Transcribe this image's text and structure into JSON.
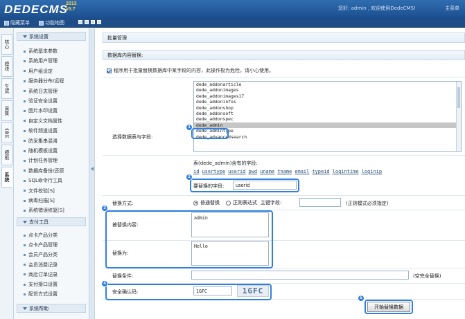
{
  "header": {
    "logo_text": "DEDECMS",
    "logo_version_top": "2013",
    "logo_version_bottom": "v5.7",
    "welcome_text": "您好: admin , 欢迎使用DedeCMS!",
    "right_link": "主菜单"
  },
  "toolbar": {
    "hide_menu": "隐藏菜单",
    "function_map": "功能地图"
  },
  "vtabs": [
    "核心",
    "模块",
    "生成",
    "采集",
    "会员",
    "模板",
    "系统"
  ],
  "sidemenu": {
    "group1_title": "系统设置",
    "group1_items": [
      "系统基本参数",
      "系统用户管理",
      "用户组设定",
      "服务器分布/远程",
      "系统日志管理",
      "验证安全设置",
      "图片水印设置",
      "自定义文档属性",
      "软件频道设置",
      "防采集串混淆",
      "随机模板设置",
      "计划任务管理",
      "数据库备份/还原",
      "SQL命令行工具",
      "文件校验[S]",
      "病毒扫描[S]",
      "系统错误修复[S]"
    ],
    "group2_title": "支付工具",
    "group2_items": [
      "点卡产品分类",
      "点卡产品管理",
      "会员产品分类",
      "会员消费记录",
      "商店订单记录",
      "支付接口设置",
      "配货方式设置"
    ],
    "group3_title": "系统帮助"
  },
  "main": {
    "title": "批量管理",
    "subtitle": "数据库内容替换:",
    "notice": "程序用于批量替换数据库中某字段的内容，此操作极为危险，请小心使用。",
    "table_label": "选择数据表与字段:",
    "tables": [
      "dede_addonarticle",
      "dede_addonimages",
      "dede_addonimages17",
      "dede_addoninfos",
      "dede_addonshop",
      "dede_addonsoft",
      "dede_addonspec",
      "dede_admin",
      "dede_admintype",
      "dede_advancedsearch"
    ],
    "selected_table": "dede_admin",
    "fields_title": "表(dede_admin)含有的字段:",
    "fields": [
      "id",
      "usertype",
      "userid",
      "pwd",
      "uname",
      "tname",
      "email",
      "typeid",
      "logintime",
      "loginip"
    ],
    "field_label": "要替换的字段:",
    "field_value": "userid",
    "mode_label": "替换方式:",
    "mode_normal": "普通替换",
    "mode_regex": "正则表达式",
    "key_field_label": "主键字段:",
    "key_field_value": "",
    "regex_note": "(正则模式必须指定)",
    "find_label": "被替换内容:",
    "find_value": "admin",
    "replace_label": "替换为:",
    "replace_value": "Hello",
    "condition_label": "替换条件:",
    "condition_value": "",
    "condition_note": "(空完全替换)",
    "captcha_label": "安全确认码:",
    "captcha_value": "1GFC",
    "captcha_image_text": "1GFC",
    "submit_label": "开始替换数据"
  },
  "annotations": [
    "1",
    "2",
    "3",
    "4",
    "5"
  ],
  "colors": {
    "header": "#2f6db0",
    "highlight": "#2f7fe0",
    "selected_row": "#c6c6c6"
  }
}
